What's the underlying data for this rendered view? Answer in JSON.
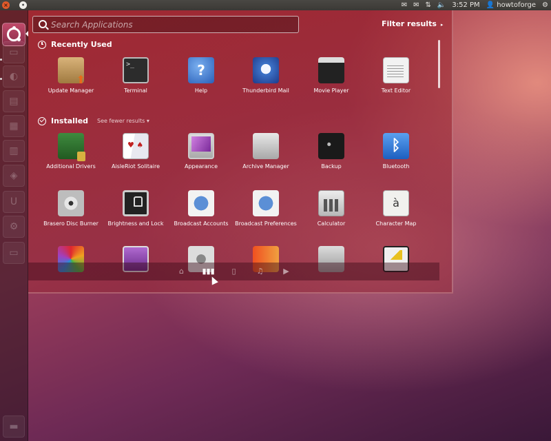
{
  "top_panel": {
    "window_close": "×",
    "window_max": "•",
    "time": "3:52 PM",
    "user": "howtoforge",
    "indicators": [
      "messaging-icon",
      "mail-icon",
      "network-icon",
      "volume-icon",
      "session-gear-icon"
    ]
  },
  "launcher": {
    "items": [
      "dash-home",
      "files",
      "firefox",
      "writer",
      "calc",
      "impress",
      "software-center",
      "ubuntu-one",
      "system-settings",
      "workspaces",
      "trash"
    ]
  },
  "dash": {
    "search_placeholder": "Search Applications",
    "filter_label": "Filter results",
    "filter_arrow": "▸",
    "recently_used_title": "Recently Used",
    "installed_title": "Installed",
    "see_fewer": "See fewer results",
    "see_fewer_arrow": "▾",
    "recently_used": [
      {
        "label": "Update Manager",
        "icon": "update-manager-icon"
      },
      {
        "label": "Terminal",
        "icon": "terminal-icon",
        "glyph": ">_"
      },
      {
        "label": "Help",
        "icon": "help-icon",
        "glyph": "?"
      },
      {
        "label": "Thunderbird Mail",
        "icon": "thunderbird-icon"
      },
      {
        "label": "Movie Player",
        "icon": "movie-player-icon"
      },
      {
        "label": "Text Editor",
        "icon": "text-editor-icon"
      }
    ],
    "installed_row1": [
      {
        "label": "Additional Drivers",
        "icon": "additional-drivers-icon"
      },
      {
        "label": "AisleRiot Solitaire",
        "icon": "solitaire-icon"
      },
      {
        "label": "Appearance",
        "icon": "appearance-icon"
      },
      {
        "label": "Archive Manager",
        "icon": "archive-manager-icon"
      },
      {
        "label": "Backup",
        "icon": "backup-icon"
      },
      {
        "label": "Bluetooth",
        "icon": "bluetooth-icon",
        "glyph": "ᛒ"
      }
    ],
    "installed_row2": [
      {
        "label": "Brasero Disc Burner",
        "icon": "brasero-icon"
      },
      {
        "label": "Brightness and Lock",
        "icon": "brightness-lock-icon"
      },
      {
        "label": "Broadcast Accounts",
        "icon": "broadcast-accounts-icon"
      },
      {
        "label": "Broadcast Preferences",
        "icon": "broadcast-preferences-icon"
      },
      {
        "label": "Calculator",
        "icon": "calculator-icon"
      },
      {
        "label": "Character Map",
        "icon": "character-map-icon",
        "glyph": "à"
      }
    ],
    "lenses": [
      {
        "icon": "home-lens-icon",
        "glyph": "⌂"
      },
      {
        "icon": "applications-lens-icon",
        "glyph": "▮▮▮"
      },
      {
        "icon": "files-lens-icon",
        "glyph": "▯"
      },
      {
        "icon": "music-lens-icon",
        "glyph": "♫"
      },
      {
        "icon": "video-lens-icon",
        "glyph": "▶"
      }
    ]
  }
}
